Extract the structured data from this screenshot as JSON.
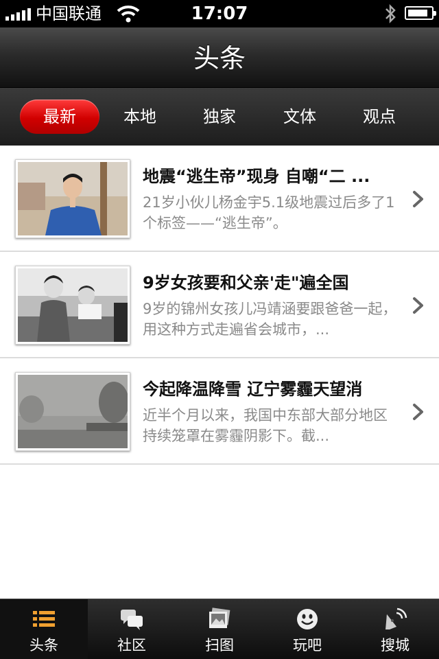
{
  "status_bar": {
    "carrier": "中国联通",
    "time": "17:07"
  },
  "nav": {
    "title": "头条"
  },
  "categories": [
    {
      "label": "最新",
      "active": true
    },
    {
      "label": "本地",
      "active": false
    },
    {
      "label": "独家",
      "active": false
    },
    {
      "label": "文体",
      "active": false
    },
    {
      "label": "观点",
      "active": false
    }
  ],
  "news": [
    {
      "headline": "地震“逃生帝”现身 自嘲“二 ...",
      "summary": "21岁小伙儿杨金宇5.1级地震过后多了1个标签——“逃生帝”。"
    },
    {
      "headline": "9岁女孩要和父亲'走\"遍全国",
      "summary": "9岁的锦州女孩儿冯靖涵要跟爸爸一起，用这种方式走遍省会城市，..."
    },
    {
      "headline": "今起降温降雪 辽宁雾霾天望消",
      "summary": "近半个月以来，我国中东部大部分地区持续笼罩在雾霾阴影下。截..."
    }
  ],
  "bottom_tabs": [
    {
      "label": "头条",
      "icon": "list-icon",
      "active": true
    },
    {
      "label": "社区",
      "icon": "chat-bubbles-icon",
      "active": false
    },
    {
      "label": "扫图",
      "icon": "photo-icon",
      "active": false
    },
    {
      "label": "玩吧",
      "icon": "smiley-icon",
      "active": false
    },
    {
      "label": "搜城",
      "icon": "satellite-dish-icon",
      "active": false
    }
  ],
  "colors": {
    "accent_red": "#d10000",
    "active_tab_icon": "#f0a030",
    "bar_dark": "#1d1d1d"
  }
}
